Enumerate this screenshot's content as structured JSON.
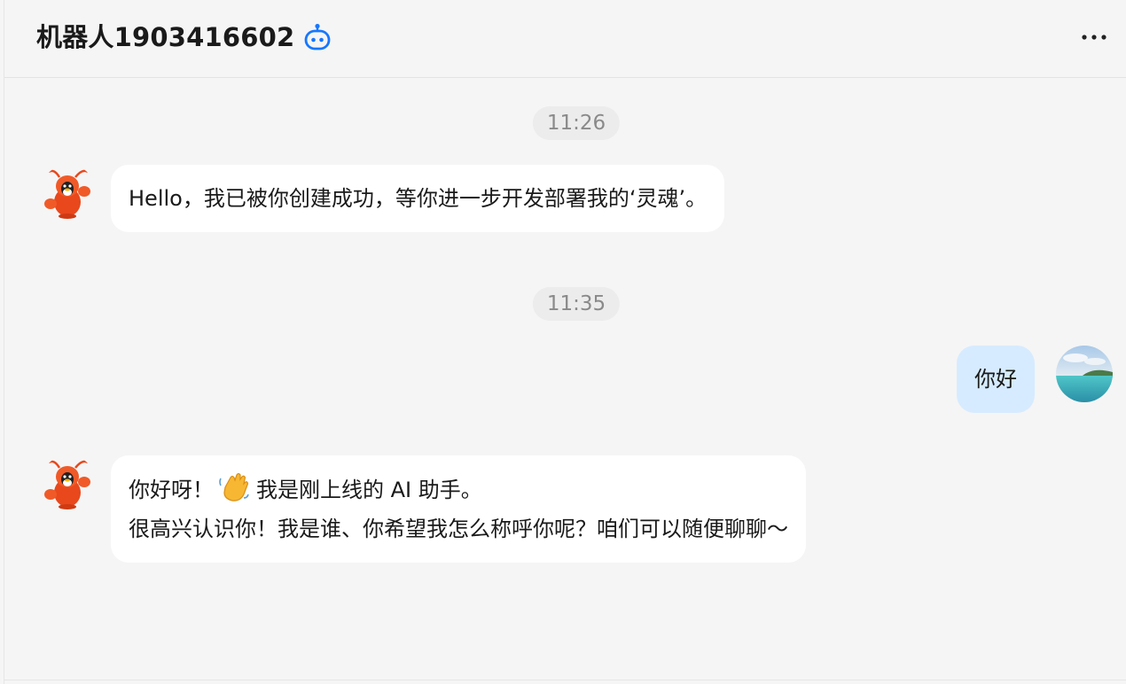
{
  "header": {
    "title": "机器人1903416602",
    "badge_icon": "robot-icon",
    "more_icon": "more-horizontal-icon",
    "accent": "#1677ff"
  },
  "messages": [
    {
      "type": "time",
      "text": "11:26"
    },
    {
      "type": "bot",
      "avatar_icon": "lobster-mascot-icon",
      "lines": [
        "Hello，我已被你创建成功，等你进一步开发部署我的‘灵魂’。"
      ]
    },
    {
      "type": "time",
      "text": "11:35"
    },
    {
      "type": "user",
      "avatar_icon": "seascape-avatar",
      "lines": [
        "你好"
      ]
    },
    {
      "type": "bot",
      "avatar_icon": "lobster-mascot-icon",
      "lines_parts": {
        "before_emoji": "你好呀！",
        "emoji_icon": "waving-hand-emoji",
        "after_emoji": "我是刚上线的 AI 助手。"
      },
      "lines": [
        "很高兴认识你！我是谁、你希望我怎么称呼你呢？咱们可以随便聊聊～"
      ]
    }
  ],
  "colors": {
    "background": "#f5f5f5",
    "bot_bubble": "#ffffff",
    "user_bubble": "#d6ebff",
    "timestamp_bg": "#ececec",
    "timestamp_text": "#8a8a8a"
  }
}
